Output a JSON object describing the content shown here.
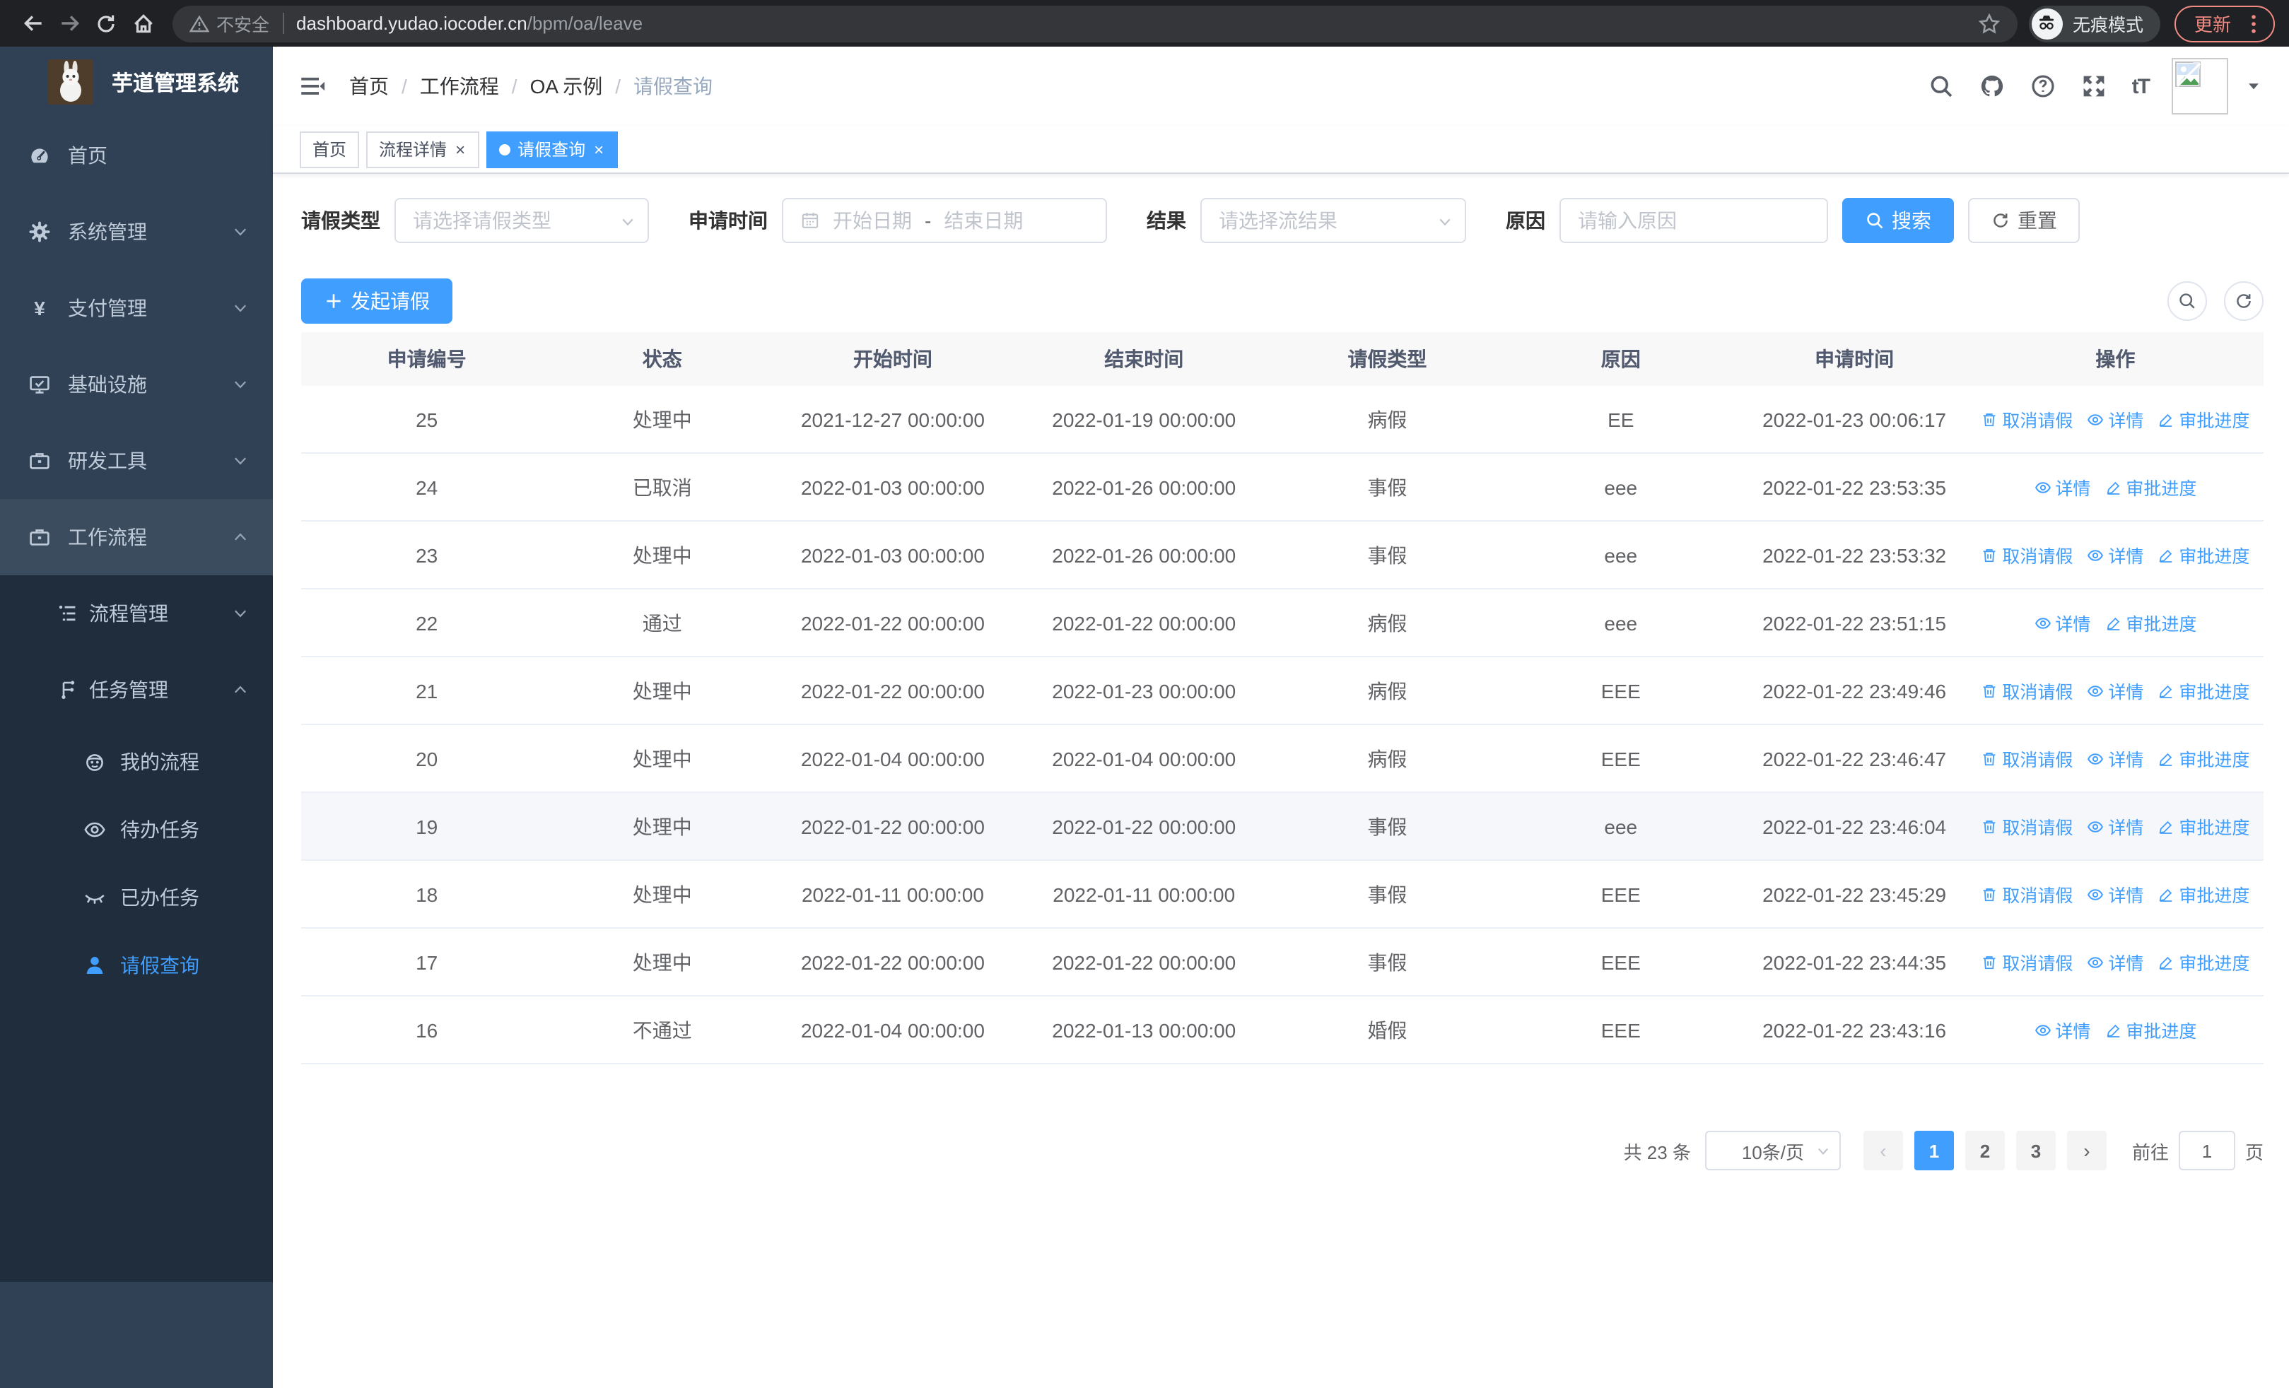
{
  "browser": {
    "security_label": "不安全",
    "url_host": "dashboard.yudao.iocoder.cn",
    "url_path": "/bpm/oa/leave",
    "incognito_label": "无痕模式",
    "update_label": "更新"
  },
  "sidebar": {
    "title": "芋道管理系统",
    "items": [
      {
        "key": "home",
        "icon": "dashboard-icon",
        "label": "首页",
        "level": 1
      },
      {
        "key": "system-mgmt",
        "icon": "gear-icon",
        "label": "系统管理",
        "level": 1,
        "chevron": "down"
      },
      {
        "key": "payment-mgmt",
        "icon": "yen-icon",
        "label": "支付管理",
        "level": 1,
        "chevron": "down"
      },
      {
        "key": "infrastructure",
        "icon": "monitor-icon",
        "label": "基础设施",
        "level": 1,
        "chevron": "down"
      },
      {
        "key": "dev-tools",
        "icon": "briefcase-icon",
        "label": "研发工具",
        "level": 1,
        "chevron": "down"
      },
      {
        "key": "workflow",
        "icon": "briefcase-icon",
        "label": "工作流程",
        "level": 1,
        "chevron": "up",
        "open": true
      },
      {
        "key": "process-mgmt",
        "icon": "list-icon",
        "label": "流程管理",
        "level": 2,
        "chevron": "down"
      },
      {
        "key": "task-mgmt",
        "icon": "tree-icon",
        "label": "任务管理",
        "level": 2,
        "chevron": "up"
      },
      {
        "key": "my-process",
        "icon": "face-icon",
        "label": "我的流程",
        "level": 3
      },
      {
        "key": "todo-tasks",
        "icon": "eye-icon",
        "label": "待办任务",
        "level": 3
      },
      {
        "key": "done-tasks",
        "icon": "eye-closed-icon",
        "label": "已办任务",
        "level": 3
      },
      {
        "key": "leave-query",
        "icon": "user-icon",
        "label": "请假查询",
        "level": 3,
        "active": true
      }
    ]
  },
  "breadcrumb": [
    "首页",
    "工作流程",
    "OA 示例",
    "请假查询"
  ],
  "tabs": [
    {
      "label": "首页",
      "closable": false,
      "active": false
    },
    {
      "label": "流程详情",
      "closable": true,
      "active": false
    },
    {
      "label": "请假查询",
      "closable": true,
      "active": true
    }
  ],
  "filters": {
    "type_label": "请假类型",
    "type_placeholder": "请选择请假类型",
    "time_label": "申请时间",
    "start_placeholder": "开始日期",
    "range_separator": "-",
    "end_placeholder": "结束日期",
    "result_label": "结果",
    "result_placeholder": "请选择流结果",
    "reason_label": "原因",
    "reason_placeholder": "请输入原因",
    "search_label": "搜索",
    "reset_label": "重置"
  },
  "toolbar": {
    "create_label": "发起请假"
  },
  "actions": {
    "cancel": "取消请假",
    "detail": "详情",
    "progress": "审批进度"
  },
  "table": {
    "columns": [
      "申请编号",
      "状态",
      "开始时间",
      "结束时间",
      "请假类型",
      "原因",
      "申请时间",
      "操作"
    ],
    "rows": [
      {
        "id": "25",
        "status": "处理中",
        "start": "2021-12-27 00:00:00",
        "end": "2022-01-19 00:00:00",
        "type": "病假",
        "reason": "EE",
        "applied": "2022-01-23 00:06:17",
        "actions": [
          "cancel",
          "detail",
          "progress"
        ]
      },
      {
        "id": "24",
        "status": "已取消",
        "start": "2022-01-03 00:00:00",
        "end": "2022-01-26 00:00:00",
        "type": "事假",
        "reason": "eee",
        "applied": "2022-01-22 23:53:35",
        "actions": [
          "detail",
          "progress"
        ]
      },
      {
        "id": "23",
        "status": "处理中",
        "start": "2022-01-03 00:00:00",
        "end": "2022-01-26 00:00:00",
        "type": "事假",
        "reason": "eee",
        "applied": "2022-01-22 23:53:32",
        "actions": [
          "cancel",
          "detail",
          "progress"
        ]
      },
      {
        "id": "22",
        "status": "通过",
        "start": "2022-01-22 00:00:00",
        "end": "2022-01-22 00:00:00",
        "type": "病假",
        "reason": "eee",
        "applied": "2022-01-22 23:51:15",
        "actions": [
          "detail",
          "progress"
        ]
      },
      {
        "id": "21",
        "status": "处理中",
        "start": "2022-01-22 00:00:00",
        "end": "2022-01-23 00:00:00",
        "type": "病假",
        "reason": "EEE",
        "applied": "2022-01-22 23:49:46",
        "actions": [
          "cancel",
          "detail",
          "progress"
        ]
      },
      {
        "id": "20",
        "status": "处理中",
        "start": "2022-01-04 00:00:00",
        "end": "2022-01-04 00:00:00",
        "type": "病假",
        "reason": "EEE",
        "applied": "2022-01-22 23:46:47",
        "actions": [
          "cancel",
          "detail",
          "progress"
        ]
      },
      {
        "id": "19",
        "status": "处理中",
        "start": "2022-01-22 00:00:00",
        "end": "2022-01-22 00:00:00",
        "type": "事假",
        "reason": "eee",
        "applied": "2022-01-22 23:46:04",
        "actions": [
          "cancel",
          "detail",
          "progress"
        ],
        "highlighted": true
      },
      {
        "id": "18",
        "status": "处理中",
        "start": "2022-01-11 00:00:00",
        "end": "2022-01-11 00:00:00",
        "type": "事假",
        "reason": "EEE",
        "applied": "2022-01-22 23:45:29",
        "actions": [
          "cancel",
          "detail",
          "progress"
        ]
      },
      {
        "id": "17",
        "status": "处理中",
        "start": "2022-01-22 00:00:00",
        "end": "2022-01-22 00:00:00",
        "type": "事假",
        "reason": "EEE",
        "applied": "2022-01-22 23:44:35",
        "actions": [
          "cancel",
          "detail",
          "progress"
        ]
      },
      {
        "id": "16",
        "status": "不通过",
        "start": "2022-01-04 00:00:00",
        "end": "2022-01-13 00:00:00",
        "type": "婚假",
        "reason": "EEE",
        "applied": "2022-01-22 23:43:16",
        "actions": [
          "detail",
          "progress"
        ]
      }
    ]
  },
  "pagination": {
    "total_label": "共 23 条",
    "page_size": "10条/页",
    "pages": [
      "1",
      "2",
      "3"
    ],
    "current": "1",
    "goto_label": "前往",
    "goto_value": "1",
    "page_unit": "页"
  },
  "colors": {
    "accent": "#409eff",
    "sidebar_bg": "#304156",
    "submenu_bg": "#1f2d3d",
    "update_pill": "#f28b82"
  }
}
